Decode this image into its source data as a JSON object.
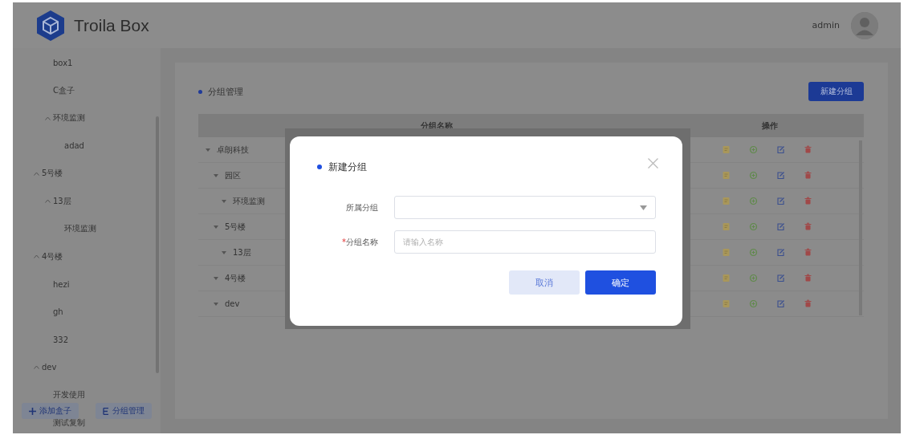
{
  "header": {
    "app_name": "Troila Box",
    "user": "admin"
  },
  "sidebar": {
    "tree": [
      {
        "children": [
          {
            "label": "box1"
          },
          {
            "label": "C盒子"
          },
          {
            "label": "环境监测",
            "expanded": true,
            "children": [
              {
                "label": "adad"
              }
            ]
          }
        ]
      },
      {
        "label": "5号楼",
        "expanded": true,
        "children": [
          {
            "label": "13层",
            "expanded": true,
            "children": [
              {
                "label": "环境监测"
              }
            ]
          }
        ]
      },
      {
        "label": "4号楼",
        "expanded": true,
        "children": [
          {
            "label": "hezi"
          },
          {
            "label": "gh"
          },
          {
            "label": "332"
          }
        ]
      },
      {
        "label": "dev",
        "expanded": true,
        "children": [
          {
            "label": "开发使用"
          },
          {
            "label": "测试复制"
          }
        ]
      }
    ],
    "buttons": [
      {
        "kind": "add",
        "label": "添加盒子"
      },
      {
        "kind": "groups",
        "label": "分组管理"
      }
    ]
  },
  "main": {
    "title": "分组管理",
    "new_button": "新建分组",
    "table": {
      "columns": [
        "分组名称",
        "操作"
      ],
      "rows": [
        {
          "name": "卓朗科技",
          "expanded": true,
          "children": [
            {
              "name": "园区",
              "expanded": true,
              "children": [
                {
                  "name": "环境监测",
                  "expanded": true
                }
              ]
            },
            {
              "name": "5号楼",
              "expanded": true,
              "children": [
                {
                  "name": "13层",
                  "expanded": true
                }
              ]
            },
            {
              "name": "4号楼",
              "expanded": true
            },
            {
              "name": "dev",
              "expanded": true
            }
          ]
        }
      ]
    }
  },
  "dialog": {
    "title": "新建分组",
    "fields": [
      {
        "kind": "select",
        "label": "所属分组"
      },
      {
        "kind": "text",
        "label": "分组名称",
        "required": true,
        "mark": "*",
        "placeholder": "请输入名称"
      }
    ],
    "buttons": [
      {
        "kind": "secondary",
        "label": "取消"
      },
      {
        "kind": "primary",
        "label": "确定"
      }
    ]
  }
}
